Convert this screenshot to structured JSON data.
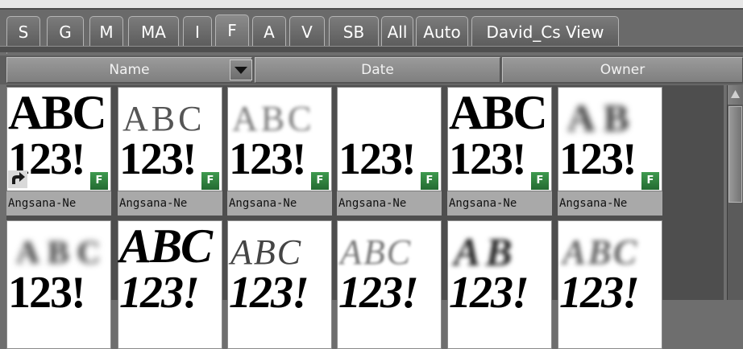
{
  "tabs": [
    {
      "label": "S"
    },
    {
      "label": "G"
    },
    {
      "label": "M"
    },
    {
      "label": "MA"
    },
    {
      "label": "I"
    },
    {
      "label": "F"
    },
    {
      "label": "A"
    },
    {
      "label": "V"
    },
    {
      "label": "SB"
    },
    {
      "label": "All"
    },
    {
      "label": "Auto"
    },
    {
      "label": "David_Cs View"
    }
  ],
  "active_tab": "F",
  "columns": {
    "name": "Name",
    "date": "Date",
    "owner": "Owner"
  },
  "tiles": [
    {
      "caption": "Angsana-Ne",
      "sample_letters": "ABC",
      "sample_numbers": "123!",
      "badge": "F"
    },
    {
      "caption": "Angsana-Ne",
      "sample_letters": "ABC",
      "sample_numbers": "123!",
      "badge": "F"
    },
    {
      "caption": "Angsana-Ne",
      "sample_letters": "ABC",
      "sample_numbers": "123!",
      "badge": "F"
    },
    {
      "caption": "Angsana-Ne",
      "sample_letters": "",
      "sample_numbers": "123!",
      "badge": "F"
    },
    {
      "caption": "Angsana-Ne",
      "sample_letters": "ABC",
      "sample_numbers": "123!",
      "badge": "F"
    },
    {
      "caption": "Angsana-Ne",
      "sample_letters": "AB",
      "sample_numbers": "123!",
      "badge": "F"
    },
    {
      "caption": "",
      "sample_letters": "ABC",
      "sample_numbers": "123!",
      "badge": ""
    },
    {
      "caption": "",
      "sample_letters": "ABC",
      "sample_numbers": "123!",
      "badge": ""
    },
    {
      "caption": "",
      "sample_letters": "ABC",
      "sample_numbers": "123!",
      "badge": ""
    },
    {
      "caption": "",
      "sample_letters": "ABC",
      "sample_numbers": "123!",
      "badge": ""
    },
    {
      "caption": "",
      "sample_letters": "AB",
      "sample_numbers": "123!",
      "badge": ""
    },
    {
      "caption": "",
      "sample_letters": "ABC",
      "sample_numbers": "123!",
      "badge": ""
    }
  ],
  "icons": {
    "sort_dropdown": "chevron-down-icon",
    "font_badge": "font-type-badge-icon",
    "link": "shortcut-arrow-icon"
  },
  "colors": {
    "badge_green": "#2f8a40",
    "panel_gray": "#6e6e6e"
  }
}
